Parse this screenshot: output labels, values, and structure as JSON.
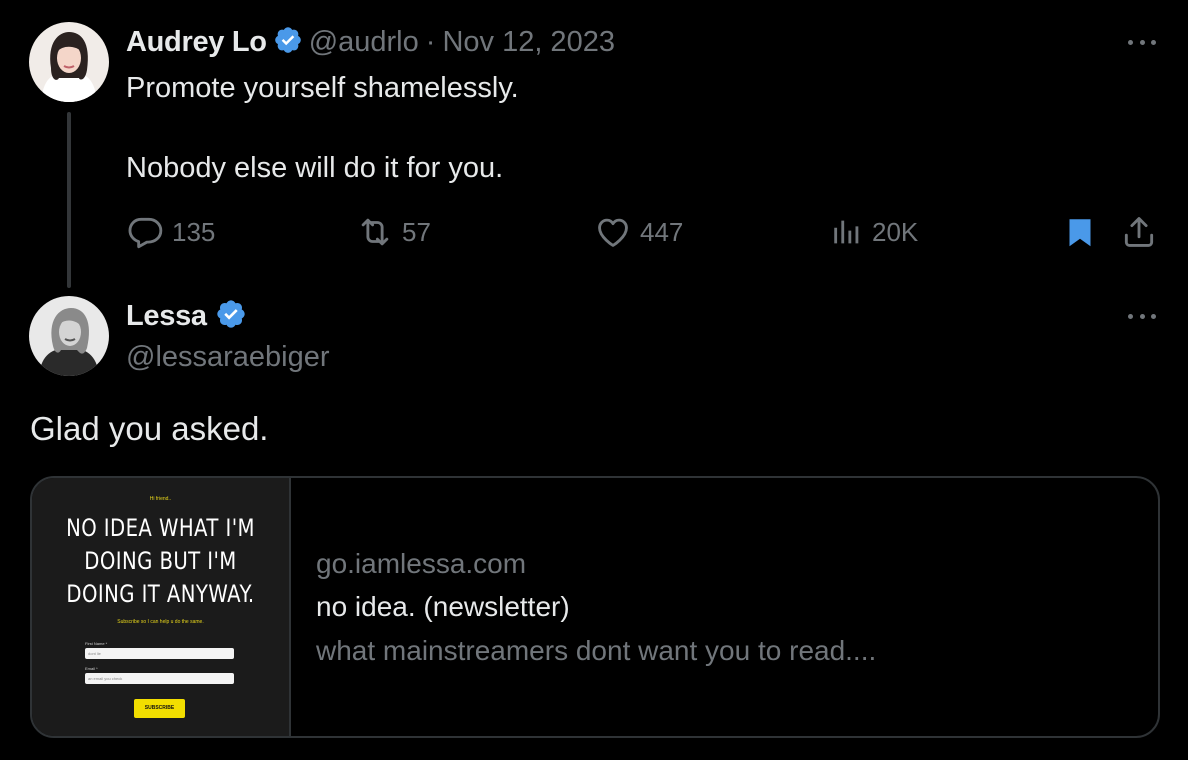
{
  "tweet": {
    "author": {
      "name": "Audrey Lo",
      "handle": "@audrlo",
      "verified": true
    },
    "separator": "·",
    "date": "Nov 12, 2023",
    "text_lines": [
      "Promote yourself shamelessly.",
      "Nobody else will do it for you."
    ],
    "stats": {
      "replies": "135",
      "reposts": "57",
      "likes": "447",
      "views": "20K"
    },
    "bookmarked": true
  },
  "reply": {
    "author": {
      "name": "Lessa",
      "handle": "@lessaraebiger",
      "verified": true
    },
    "text": "Glad you asked.",
    "link_card": {
      "thumbnail": {
        "greeting": "Hi friend..",
        "headline_lines": [
          "NO IDEA WHAT I'M",
          "DOING BUT I'M",
          "DOING IT ANYWAY."
        ],
        "subtitle": "Subscribe so I can help u do the same.",
        "first_name_label": "First Name *",
        "first_name_placeholder": "dont lie",
        "email_label": "Email *",
        "email_placeholder": "an email you check",
        "button_label": "SUBSCRIBE"
      },
      "domain": "go.iamlessa.com",
      "title": "no idea. (newsletter)",
      "description": "what mainstreamers dont want you to read...."
    }
  },
  "colors": {
    "background": "#000000",
    "text_primary": "#e7e9ea",
    "text_secondary": "#71767b",
    "verified_badge": "#4a99e9",
    "bookmark_active": "#4a99e9",
    "border": "#2f3336",
    "thumbnail_accent": "#f2de00"
  },
  "icons": {
    "reply": "speech-bubble-icon",
    "repost": "repost-arrows-icon",
    "like": "heart-icon",
    "views": "bar-chart-icon",
    "bookmark": "bookmark-icon",
    "share": "share-upload-icon",
    "more": "more-horizontal-icon",
    "verified": "verified-badge-icon"
  }
}
